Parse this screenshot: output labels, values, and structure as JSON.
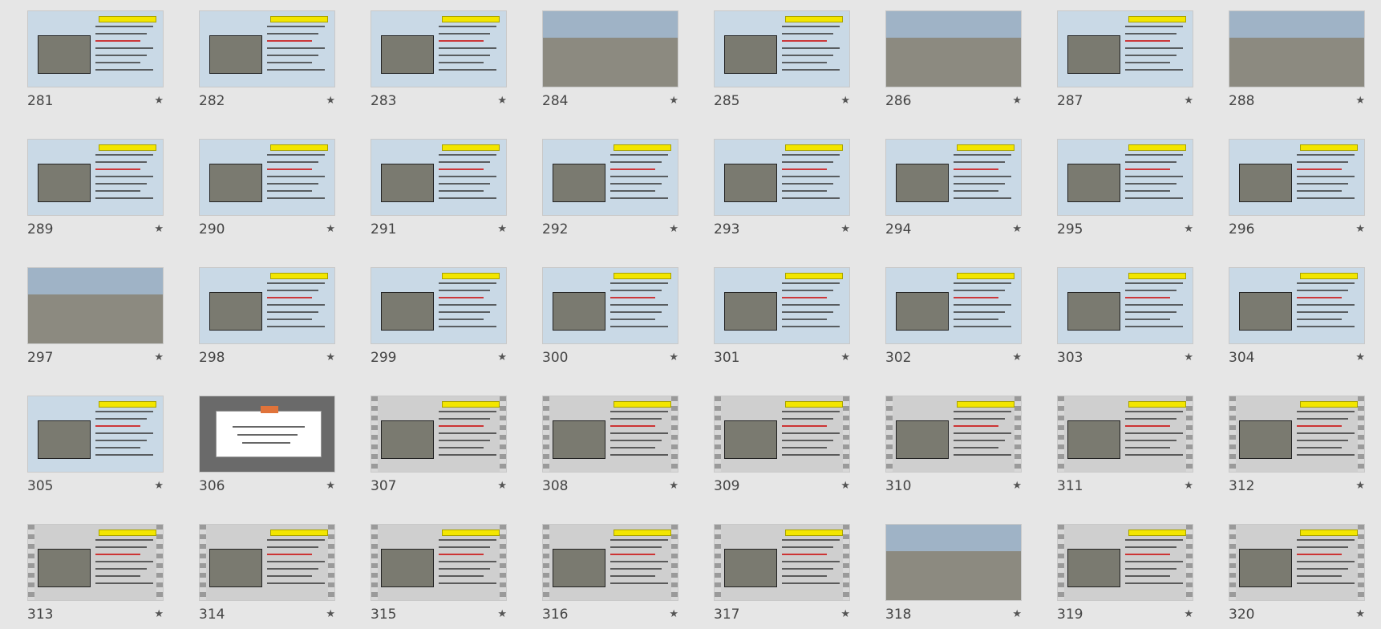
{
  "slides": [
    {
      "n": "281",
      "kind": "blue"
    },
    {
      "n": "282",
      "kind": "blue"
    },
    {
      "n": "283",
      "kind": "blue"
    },
    {
      "n": "284",
      "kind": "photo"
    },
    {
      "n": "285",
      "kind": "blue"
    },
    {
      "n": "286",
      "kind": "photo"
    },
    {
      "n": "287",
      "kind": "blue"
    },
    {
      "n": "288",
      "kind": "photo"
    },
    {
      "n": "289",
      "kind": "blue"
    },
    {
      "n": "290",
      "kind": "blue"
    },
    {
      "n": "291",
      "kind": "blue"
    },
    {
      "n": "292",
      "kind": "blue"
    },
    {
      "n": "293",
      "kind": "blue"
    },
    {
      "n": "294",
      "kind": "blue"
    },
    {
      "n": "295",
      "kind": "blue"
    },
    {
      "n": "296",
      "kind": "blue"
    },
    {
      "n": "297",
      "kind": "photo"
    },
    {
      "n": "298",
      "kind": "blue"
    },
    {
      "n": "299",
      "kind": "blue"
    },
    {
      "n": "300",
      "kind": "blue"
    },
    {
      "n": "301",
      "kind": "blue"
    },
    {
      "n": "302",
      "kind": "blue"
    },
    {
      "n": "303",
      "kind": "blue"
    },
    {
      "n": "304",
      "kind": "blue"
    },
    {
      "n": "305",
      "kind": "blue"
    },
    {
      "n": "306",
      "kind": "dark"
    },
    {
      "n": "307",
      "kind": "gray"
    },
    {
      "n": "308",
      "kind": "gray"
    },
    {
      "n": "309",
      "kind": "gray"
    },
    {
      "n": "310",
      "kind": "gray"
    },
    {
      "n": "311",
      "kind": "gray"
    },
    {
      "n": "312",
      "kind": "gray"
    },
    {
      "n": "313",
      "kind": "gray"
    },
    {
      "n": "314",
      "kind": "gray"
    },
    {
      "n": "315",
      "kind": "gray"
    },
    {
      "n": "316",
      "kind": "gray"
    },
    {
      "n": "317",
      "kind": "gray"
    },
    {
      "n": "318",
      "kind": "photo"
    },
    {
      "n": "319",
      "kind": "gray"
    },
    {
      "n": "320",
      "kind": "gray"
    }
  ],
  "star_glyph": "★",
  "colors": {
    "background": "#e6e6e6",
    "slide_blue": "#c9d9e6",
    "title_yellow": "#f3e600"
  }
}
